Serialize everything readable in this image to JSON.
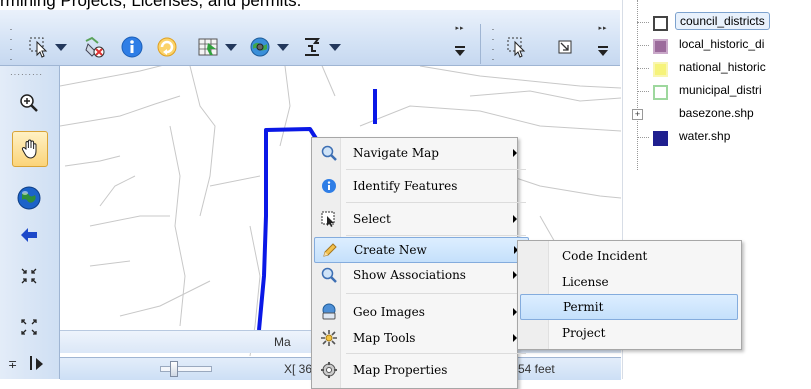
{
  "header": {
    "text": "rmining Projects, Licenses, and permits."
  },
  "toolbar": {
    "icons": [
      "select-pointer-icon",
      "remove-selection-icon",
      "info-icon",
      "refresh-icon",
      "add-layer-icon",
      "globe-layer-icon",
      "measure-icon",
      "overflow-icon",
      "select-pointer-icon",
      "zoom-box-icon",
      "overflow-icon"
    ]
  },
  "left_toolbar": {
    "icons": [
      "zoom-in-icon",
      "pan-hand-icon",
      "globe-icon",
      "back-arrow-icon",
      "zoom-out-full-icon",
      "zoom-extent-icon"
    ]
  },
  "status_bar": {
    "map_label": "Ma",
    "coords": "X[ 36",
    "scale": "54 feet"
  },
  "layers": [
    {
      "label": "council_districts",
      "color": "#ffffff",
      "border": "#444444",
      "selected": true
    },
    {
      "label": "local_historic_di",
      "color": "#9c6b9c",
      "border": "#7d4f7d"
    },
    {
      "label": "national_historic",
      "color": "#f6f37a",
      "border": "#d8d35a"
    },
    {
      "label": "municipal_distri",
      "color": "#ffffff",
      "border": "#8fd08f"
    },
    {
      "label": "basezone.shp",
      "color": null,
      "expander": "+"
    },
    {
      "label": "water.shp",
      "color": "#1f1f8f",
      "border": "#1f1f8f"
    }
  ],
  "context_menu": {
    "items": [
      {
        "label": "Navigate Map",
        "icon": "magnifier-icon",
        "submenu": true
      },
      {
        "label": "Identify Features",
        "icon": "info-icon",
        "submenu": false
      },
      {
        "label": "Select",
        "icon": "select-cursor-icon",
        "submenu": true
      },
      {
        "label": "Create New",
        "icon": "pencil-icon",
        "submenu": true,
        "active": true
      },
      {
        "label": "Show Associations",
        "icon": "magnifier-icon",
        "submenu": true
      },
      {
        "label": "Geo Images",
        "icon": "geo-image-icon",
        "submenu": true
      },
      {
        "label": "Map Tools",
        "icon": "tools-icon",
        "submenu": true
      },
      {
        "label": "Map Properties",
        "icon": "properties-icon",
        "submenu": false
      }
    ]
  },
  "submenu": {
    "items": [
      {
        "label": "Code Incident"
      },
      {
        "label": "License"
      },
      {
        "label": "Permit",
        "active": true
      },
      {
        "label": "Project"
      }
    ]
  }
}
